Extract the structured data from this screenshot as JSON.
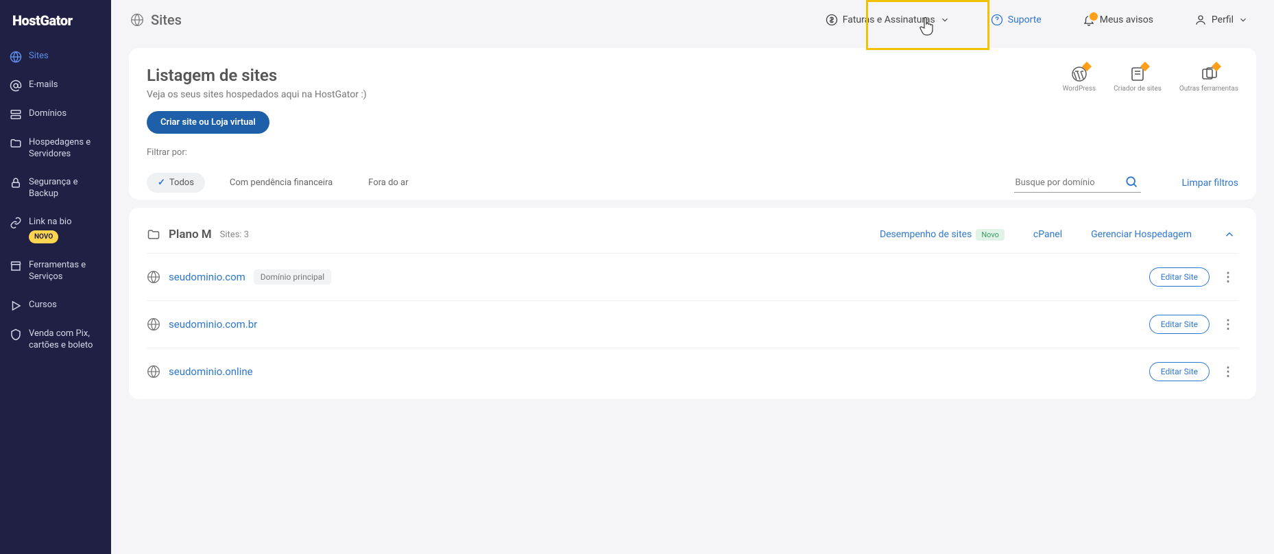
{
  "brand": "HostGator",
  "page_title": "Sites",
  "topnav": {
    "billing": "Faturas e Assinaturas",
    "support": "Suporte",
    "notices": "Meus avisos",
    "profile": "Perfil"
  },
  "sidebar": {
    "items": [
      {
        "label": "Sites"
      },
      {
        "label": "E-mails"
      },
      {
        "label": "Domínios"
      },
      {
        "label": "Hospedagens e Servidores"
      },
      {
        "label": "Segurança e Backup"
      },
      {
        "label": "Link na bio",
        "badge": "NOVO"
      },
      {
        "label": "Ferramentas e Serviços"
      },
      {
        "label": "Cursos"
      },
      {
        "label": "Venda com Pix, cartões e boleto"
      }
    ]
  },
  "listing": {
    "heading": "Listagem de sites",
    "subtitle": "Veja os seus sites hospedados aqui na HostGator :)",
    "create_btn": "Criar site ou Loja virtual",
    "quick": {
      "wordpress": "WordPress",
      "builder": "Criador de sites",
      "other": "Outras ferramentas"
    },
    "filter_label": "Filtrar por:",
    "chips": {
      "all": "Todos",
      "pending": "Com pendência financeira",
      "offline": "Fora do ar"
    },
    "search_placeholder": "Busque por domínio",
    "clear": "Limpar filtros"
  },
  "plan": {
    "name": "Plano M",
    "sites_label": "Sites:",
    "sites_count": "3",
    "performance": "Desempenho de sites",
    "novo": "Novo",
    "cpanel": "cPanel",
    "manage": "Gerenciar Hospedagem",
    "rows": [
      {
        "domain": "seudominio.com",
        "tag": "Domínio principal",
        "edit": "Editar Site"
      },
      {
        "domain": "seudominio.com.br",
        "edit": "Editar Site"
      },
      {
        "domain": "seudominio.online",
        "edit": "Editar Site"
      }
    ]
  }
}
